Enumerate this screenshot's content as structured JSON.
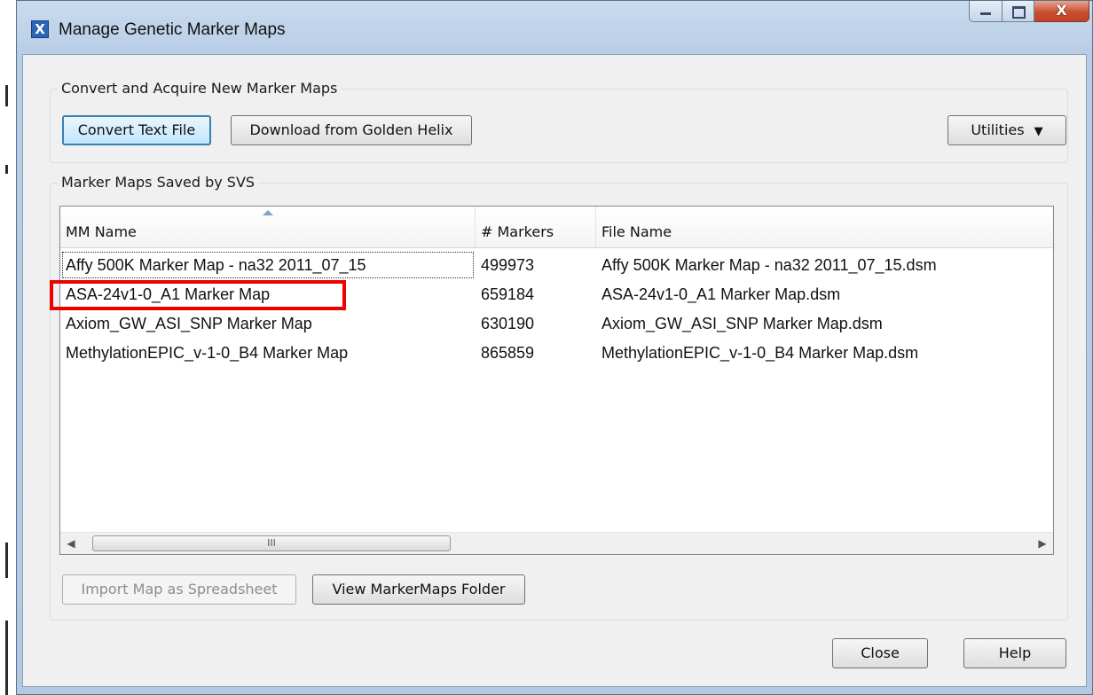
{
  "window": {
    "title": "Manage Genetic Marker Maps",
    "close_glyph": "X",
    "app_icon_glyph": "X",
    "icons": {
      "app": "golden-helix-app-icon",
      "minimize": "minimize-icon",
      "maximize": "maximize-icon",
      "close": "close-icon"
    }
  },
  "convert_group": {
    "legend": "Convert and Acquire New Marker Maps",
    "convert_button": "Convert Text File",
    "download_button": "Download from Golden Helix",
    "utilities_button": "Utilities",
    "utilities_arrow": "▼"
  },
  "saved_group": {
    "legend": "Marker Maps Saved by SVS",
    "columns": [
      "MM Name",
      "# Markers",
      "File Name"
    ],
    "sorted_column": "MM Name",
    "rows": [
      {
        "name": "Affy 500K Marker Map - na32 2011_07_15",
        "markers": "499973",
        "file": "Affy 500K Marker Map - na32 2011_07_15.dsm"
      },
      {
        "name": "ASA-24v1-0_A1 Marker Map",
        "markers": "659184",
        "file": "ASA-24v1-0_A1 Marker Map.dsm"
      },
      {
        "name": "Axiom_GW_ASI_SNP Marker Map",
        "markers": "630190",
        "file": "Axiom_GW_ASI_SNP Marker Map.dsm"
      },
      {
        "name": "MethylationEPIC_v-1-0_B4 Marker Map",
        "markers": "865859",
        "file": "MethylationEPIC_v-1-0_B4 Marker Map.dsm"
      }
    ],
    "focused_row": 0,
    "highlighted_row": 1,
    "highlight_color": "#ee0000",
    "scroll_left": "◀",
    "scroll_right": "▶",
    "scroll_grip": "III",
    "import_button": "Import Map as Spreadsheet",
    "import_enabled": false,
    "view_folder_button": "View MarkerMaps Folder"
  },
  "footer": {
    "close_button": "Close",
    "help_button": "Help"
  }
}
